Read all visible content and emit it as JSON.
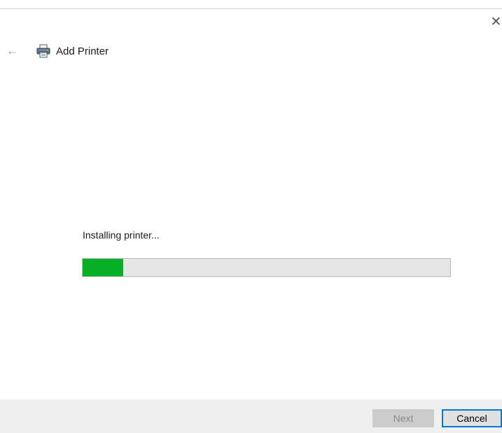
{
  "window": {
    "close_glyph": "✕",
    "back_glyph": "←"
  },
  "header": {
    "title": "Add Printer",
    "icon": "printer-icon"
  },
  "main": {
    "status_text": "Installing printer...",
    "progress_percent": 11,
    "progress_color": "#06b025"
  },
  "footer": {
    "next_label": "Next",
    "cancel_label": "Cancel",
    "accent": "#0078d7"
  }
}
